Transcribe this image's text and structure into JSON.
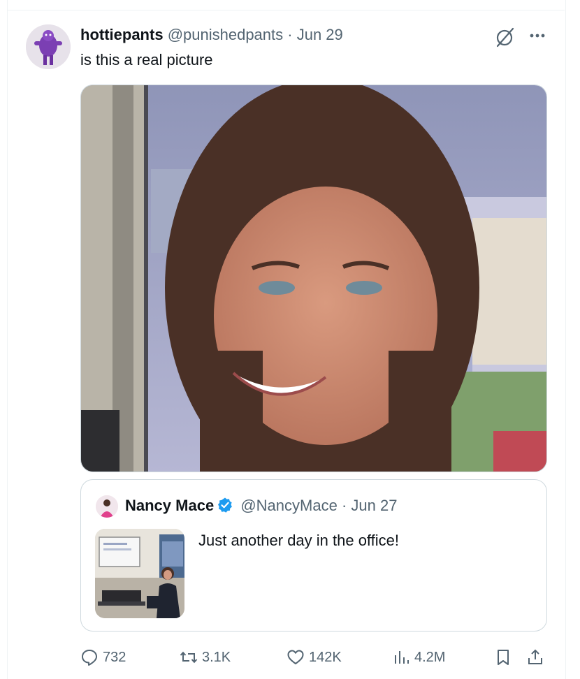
{
  "tweet": {
    "display_name": "hottiepants",
    "handle": "@punishedpants",
    "separator": "·",
    "date": "Jun 29",
    "text": "is this a real picture"
  },
  "quoted": {
    "display_name": "Nancy Mace",
    "handle": "@NancyMace",
    "separator": "·",
    "date": "Jun 27",
    "text": "Just another day in the office!"
  },
  "actions": {
    "replies": "732",
    "reposts": "3.1K",
    "likes": "142K",
    "views": "4.2M"
  },
  "icons": [
    "grok-icon",
    "more-icon",
    "verified-icon",
    "reply-icon",
    "repost-icon",
    "like-icon",
    "views-icon",
    "bookmark-icon",
    "share-icon"
  ],
  "colors": {
    "text_primary": "#0f1419",
    "text_secondary": "#536471",
    "border": "#cfd9de",
    "verified_blue": "#1d9bf0"
  }
}
